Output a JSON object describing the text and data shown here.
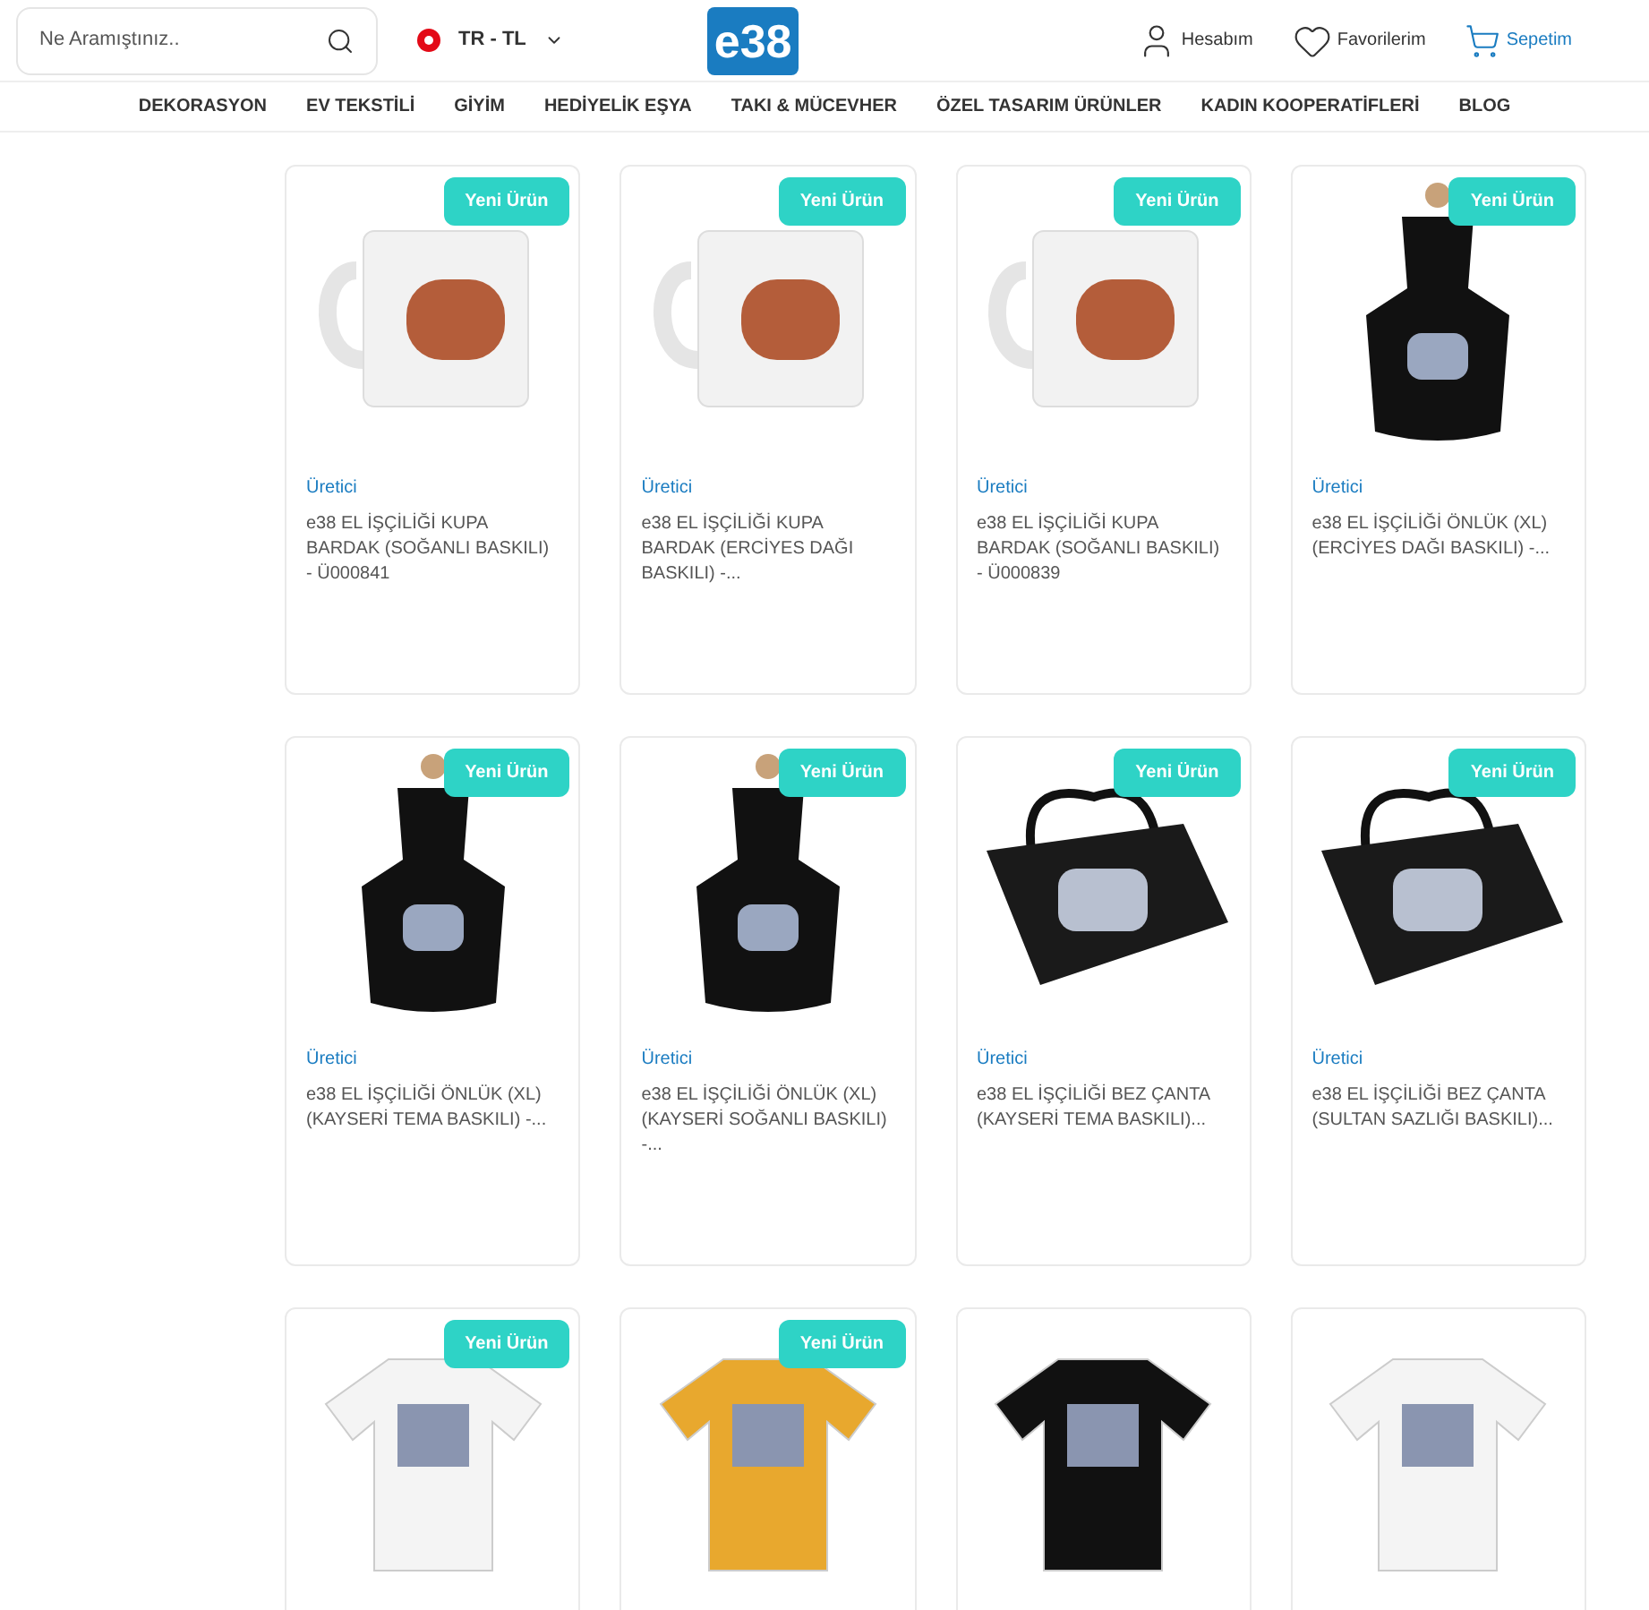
{
  "header": {
    "search": {
      "placeholder": "Ne Aramıştınız.."
    },
    "locale": "TR - TL",
    "logo": "e38",
    "account": "Hesabım",
    "favorites": "Favorilerim",
    "cart": "Sepetim"
  },
  "nav": [
    "DEKORASYON",
    "EV TEKSTİLİ",
    "GİYİM",
    "HEDİYELİK EŞYA",
    "TAKI & MÜCEVHER",
    "ÖZEL TASARIM ÜRÜNLER",
    "KADIN KOOPERATİFLERİ",
    "BLOG"
  ],
  "products": [
    {
      "kind": "mug",
      "badge": "Yeni Ürün",
      "vendor": "Üretici",
      "name": "e38 EL İŞÇİLİĞİ KUPA BARDAK (SOĞANLI BASKILI) - Ü000841"
    },
    {
      "kind": "mug",
      "badge": "Yeni Ürün",
      "vendor": "Üretici",
      "name": "e38 EL İŞÇİLİĞİ KUPA BARDAK (ERCİYES DAĞI BASKILI) -..."
    },
    {
      "kind": "mug",
      "badge": "Yeni Ürün",
      "vendor": "Üretici",
      "name": "e38 EL İŞÇİLİĞİ KUPA BARDAK (SOĞANLI BASKILI) - Ü000839"
    },
    {
      "kind": "apron",
      "badge": "Yeni Ürün",
      "vendor": "Üretici",
      "name": "e38 EL İŞÇİLİĞİ ÖNLÜK (XL) (ERCİYES DAĞI BASKILI) -..."
    },
    {
      "kind": "apron",
      "badge": "Yeni Ürün",
      "vendor": "Üretici",
      "name": "e38 EL İŞÇİLİĞİ ÖNLÜK (XL) (KAYSERİ TEMA BASKILI) -..."
    },
    {
      "kind": "apron",
      "badge": "Yeni Ürün",
      "vendor": "Üretici",
      "name": "e38 EL İŞÇİLİĞİ ÖNLÜK (XL) (KAYSERİ SOĞANLI BASKILI) -..."
    },
    {
      "kind": "bag",
      "badge": "Yeni Ürün",
      "vendor": "Üretici",
      "name": "e38 EL İŞÇİLİĞİ BEZ ÇANTA (KAYSERİ TEMA BASKILI)..."
    },
    {
      "kind": "bag",
      "badge": "Yeni Ürün",
      "vendor": "Üretici",
      "name": "e38 EL İŞÇİLİĞİ BEZ ÇANTA (SULTAN SAZLIĞI BASKILI)..."
    },
    {
      "kind": "tshirt-white",
      "badge": "Yeni Ürün"
    },
    {
      "kind": "tshirt-yellow",
      "badge": "Yeni Ürün"
    },
    {
      "kind": "tshirt-black"
    },
    {
      "kind": "tshirt-white"
    }
  ]
}
